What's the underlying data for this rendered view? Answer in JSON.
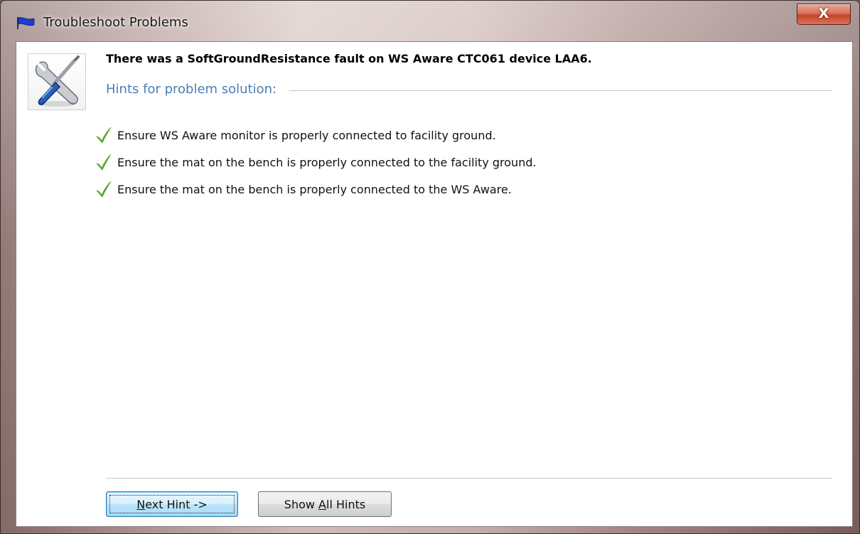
{
  "window": {
    "title": "Troubleshoot Problems",
    "close_glyph": "X"
  },
  "fault": {
    "message": "There was a SoftGroundResistance fault on WS Aware CTC061 device LAA6."
  },
  "hints": {
    "section_title": "Hints for problem solution:",
    "items": [
      {
        "text": "Ensure WS Aware monitor is properly connected to facility ground.",
        "icon": "check-icon"
      },
      {
        "text": "Ensure the mat on the bench is properly connected to the facility ground.",
        "icon": "check-icon"
      },
      {
        "text": "Ensure the mat on the bench is properly connected to the WS Aware.",
        "icon": "check-icon"
      }
    ]
  },
  "buttons": {
    "next_hint": {
      "mnemonic": "N",
      "rest": "ext Hint ->"
    },
    "show_all": {
      "before": "Show ",
      "mnemonic": "A",
      "after": "ll Hints"
    }
  },
  "colors": {
    "accent_heading": "#4a7fb5",
    "check": "#5cb82a",
    "close_button": "#c6452b"
  }
}
